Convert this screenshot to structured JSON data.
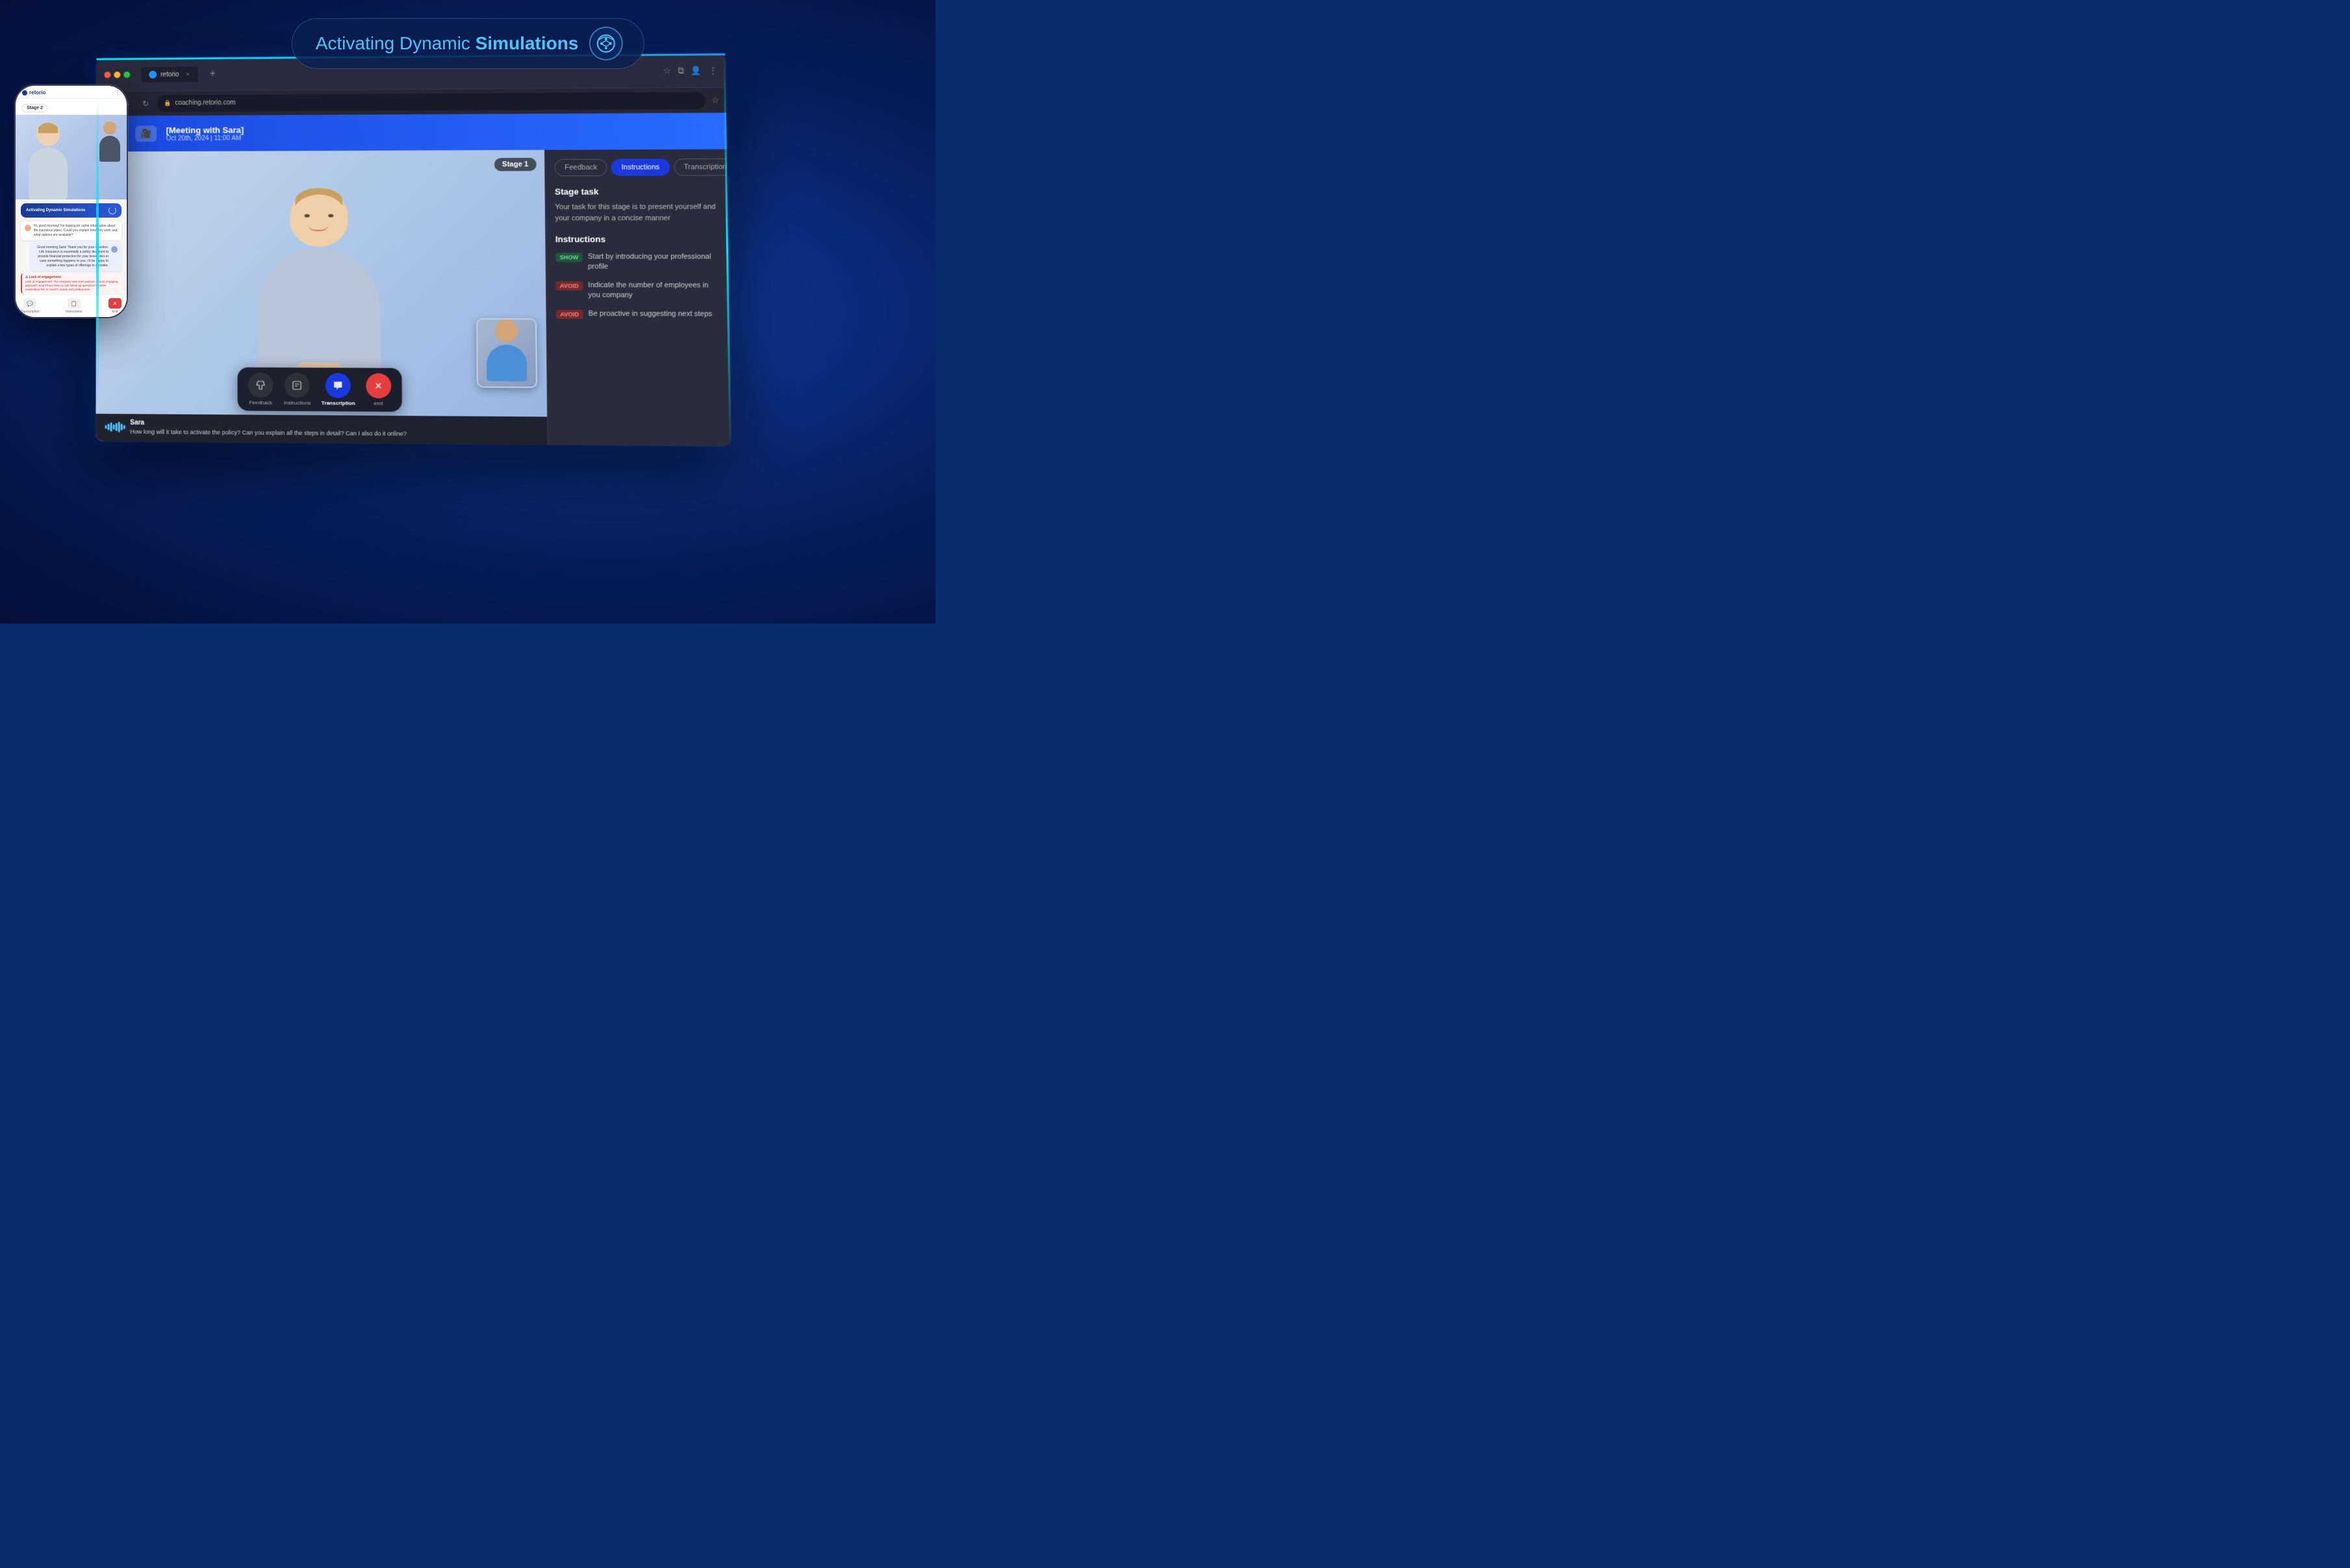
{
  "title": {
    "main": "Activating Dynamic",
    "bold": "Simulations",
    "icon": "↻"
  },
  "phone": {
    "logo": "retorio",
    "stage_badge": "Stage 2",
    "banner_text": "Activating Dynamic Simulations",
    "chat_bubble_1": "Hi, good morning! I'm looking for some information about life insurance plans. Could you explain how they work and what options are available?",
    "chat_bubble_2": "Good morning Sara! Thank you for your question. Life Insurance is essentially a policy designed to provide financial protection for your loved ones in case something happens to you. I'd be happy to explain a few types of offerings to consider.",
    "feedback_text": "Lack of engagement: The response was a bit passive. A more engaging approach would have been to ask follow-up questions to better understand the AI coach's needs and preferences.",
    "footer_labels": [
      "Transcription",
      "Instructions",
      "End"
    ]
  },
  "browser": {
    "tab_label": "retorio",
    "url": "coaching.retorio.com",
    "meeting_title": "[Meeting with Sara]",
    "meeting_time": "Oct 20th, 2024 | 11:00 AM",
    "stage_badge": "Stage 1",
    "speaker_name": "Sara",
    "transcription": "How long will it take to activate the policy? Can you explain all the steps in detail?  Can I also do it online?",
    "controls": [
      {
        "label": "Feedback",
        "active": false
      },
      {
        "label": "Instructions",
        "active": false
      },
      {
        "label": "Transcription",
        "active": true
      },
      {
        "label": "end",
        "active": false,
        "is_end": true
      }
    ],
    "panel": {
      "tabs": [
        "Feedback",
        "Instructions",
        "Transcription"
      ],
      "active_tab": "Instructions",
      "stage_task_title": "Stage task",
      "stage_task_desc": "Your task for this stage is to present yourself and your company in a concise manner",
      "instructions_title": "Instructions",
      "instructions": [
        {
          "type": "SHOW",
          "text": "Start by introducing your professional profile"
        },
        {
          "type": "AVOID",
          "text": "Indicate the number of employees in you company"
        },
        {
          "type": "AVOID",
          "text": "Be proactive in suggesting next steps"
        }
      ]
    }
  }
}
